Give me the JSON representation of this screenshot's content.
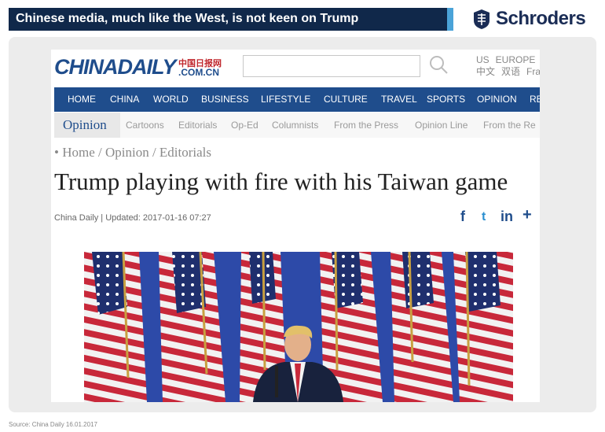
{
  "slide": {
    "title": "Chinese media, much like the West, is not keen on Trump",
    "logo_text": "Schroders",
    "source": "Source: China Daily 16.01.2017",
    "colors": {
      "header_bg": "#10284a",
      "accent": "#4aa3d8",
      "brand": "#1a2c55"
    }
  },
  "site": {
    "logo_main": "CHINADAILY",
    "logo_cn": "中国日报网",
    "logo_domain": ".COM.CN",
    "search_placeholder": "",
    "lang_line1": [
      "US",
      "EUROPE"
    ],
    "lang_line2": [
      "中文",
      "双语",
      "Fra"
    ],
    "nav_main": [
      "HOME",
      "CHINA",
      "WORLD",
      "BUSINESS",
      "LIFESTYLE",
      "CULTURE",
      "TRAVEL",
      "SPORTS",
      "OPINION",
      "RE"
    ],
    "nav_sub_active": "Opinion",
    "nav_sub": [
      "Cartoons",
      "Editorials",
      "Op-Ed",
      "Columnists",
      "From the Press",
      "Opinion Line",
      "From the Re"
    ],
    "breadcrumb": "• Home / Opinion / Editorials",
    "headline": "Trump playing with fire with his Taiwan game",
    "meta": "China Daily | Updated: 2017-01-16 07:27",
    "share_icons": [
      "facebook-icon",
      "twitter-icon",
      "linkedin-icon",
      "plus-icon"
    ],
    "share_glyphs": [
      "f",
      "t",
      "in",
      "+"
    ],
    "colors": {
      "brand_blue": "#1f4d8c",
      "red": "#c0272d"
    }
  }
}
